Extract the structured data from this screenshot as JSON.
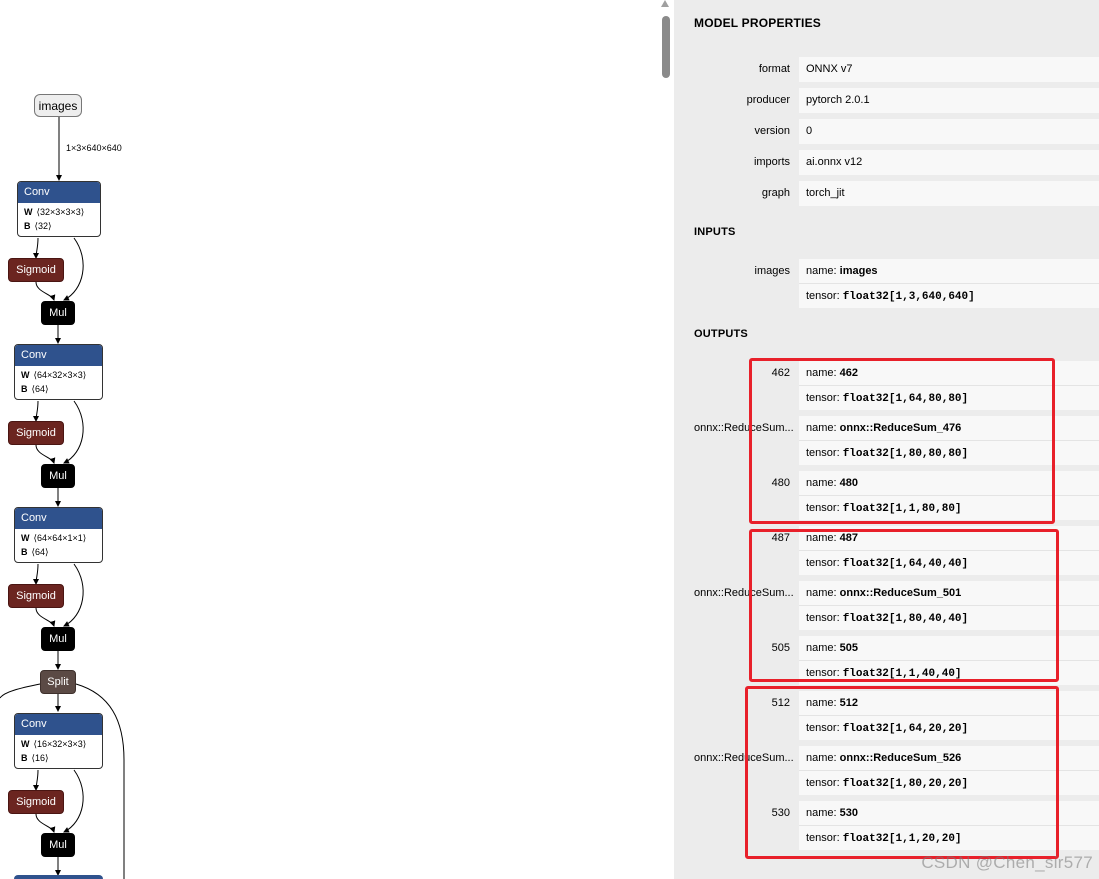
{
  "graph": {
    "input_label": "images",
    "input_shape": "1×3×640×640",
    "blocks": [
      {
        "conv": "Conv",
        "w_key": "W",
        "w": "⟨32×3×3×3⟩",
        "b_key": "B",
        "b": "⟨32⟩",
        "sigmoid": "Sigmoid",
        "mul": "Mul"
      },
      {
        "conv": "Conv",
        "w_key": "W",
        "w": "⟨64×32×3×3⟩",
        "b_key": "B",
        "b": "⟨64⟩",
        "sigmoid": "Sigmoid",
        "mul": "Mul"
      },
      {
        "conv": "Conv",
        "w_key": "W",
        "w": "⟨64×64×1×1⟩",
        "b_key": "B",
        "b": "⟨64⟩",
        "sigmoid": "Sigmoid",
        "mul": "Mul"
      },
      {
        "conv": "Conv",
        "w_key": "W",
        "w": "⟨16×32×3×3⟩",
        "b_key": "B",
        "b": "⟨16⟩",
        "sigmoid": "Sigmoid",
        "mul": "Mul"
      }
    ],
    "split_label": "Split"
  },
  "properties": {
    "title": "MODEL PROPERTIES",
    "rows": [
      {
        "label": "format",
        "value": "ONNX v7"
      },
      {
        "label": "producer",
        "value": "pytorch 2.0.1"
      },
      {
        "label": "version",
        "value": "0"
      },
      {
        "label": "imports",
        "value": "ai.onnx v12"
      },
      {
        "label": "graph",
        "value": "torch_jit"
      }
    ],
    "inputs_title": "INPUTS",
    "inputs": [
      {
        "label": "images",
        "name_key": "name:",
        "name": "images",
        "tensor_key": "tensor:",
        "tensor": "float32[1,3,640,640]"
      }
    ],
    "outputs_title": "OUTPUTS",
    "outputs": [
      {
        "label": "462",
        "name_key": "name:",
        "name": "462",
        "tensor_key": "tensor:",
        "tensor": "float32[1,64,80,80]"
      },
      {
        "label": "onnx::ReduceSum...",
        "name_key": "name:",
        "name": "onnx::ReduceSum_476",
        "tensor_key": "tensor:",
        "tensor": "float32[1,80,80,80]"
      },
      {
        "label": "480",
        "name_key": "name:",
        "name": "480",
        "tensor_key": "tensor:",
        "tensor": "float32[1,1,80,80]"
      },
      {
        "label": "487",
        "name_key": "name:",
        "name": "487",
        "tensor_key": "tensor:",
        "tensor": "float32[1,64,40,40]"
      },
      {
        "label": "onnx::ReduceSum...",
        "name_key": "name:",
        "name": "onnx::ReduceSum_501",
        "tensor_key": "tensor:",
        "tensor": "float32[1,80,40,40]"
      },
      {
        "label": "505",
        "name_key": "name:",
        "name": "505",
        "tensor_key": "tensor:",
        "tensor": "float32[1,1,40,40]"
      },
      {
        "label": "512",
        "name_key": "name:",
        "name": "512",
        "tensor_key": "tensor:",
        "tensor": "float32[1,64,20,20]"
      },
      {
        "label": "onnx::ReduceSum...",
        "name_key": "name:",
        "name": "onnx::ReduceSum_526",
        "tensor_key": "tensor:",
        "tensor": "float32[1,80,20,20]"
      },
      {
        "label": "530",
        "name_key": "name:",
        "name": "530",
        "tensor_key": "tensor:",
        "tensor": "float32[1,1,20,20]"
      }
    ]
  },
  "watermark": "CSDN @Chen_sir577",
  "colors": {
    "conv_header": "#2f528d",
    "sigmoid": "#6b2520",
    "mul": "#000000",
    "split": "#5b4a45",
    "highlight": "#e8202a"
  }
}
